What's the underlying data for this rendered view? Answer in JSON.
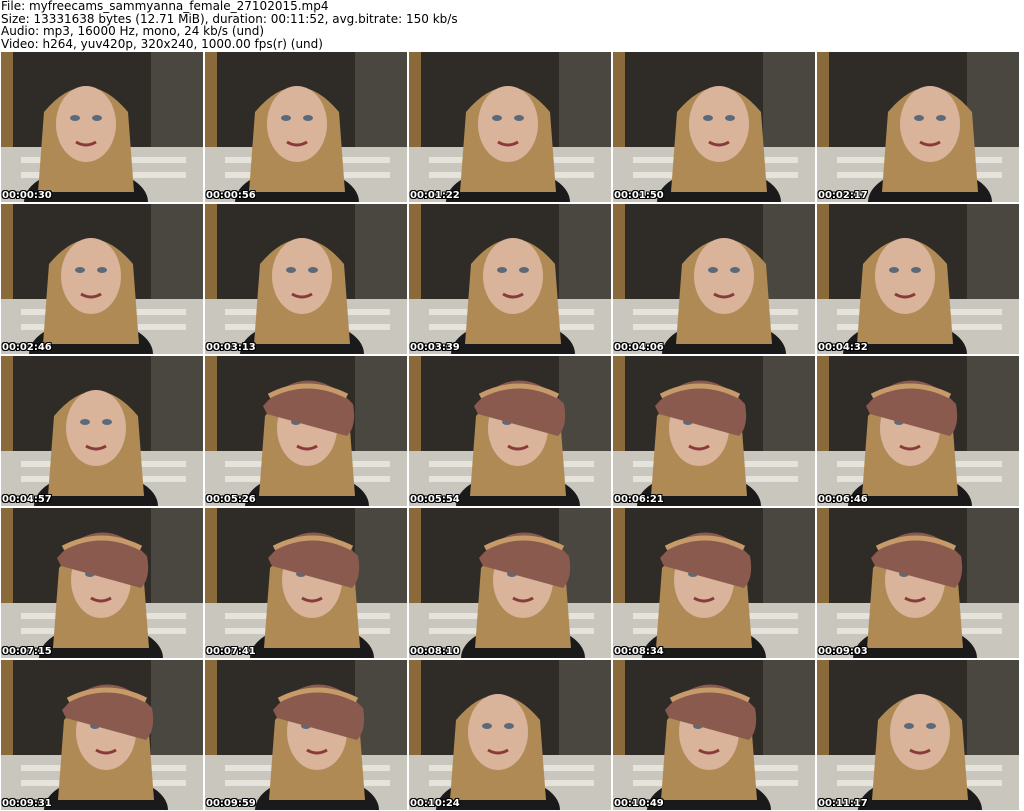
{
  "header": {
    "file_line": "File: myfreecams_sammyanna_female_27102015.mp4",
    "size_line": "Size: 13331638 bytes (12.71 MiB), duration: 00:11:52, avg.bitrate: 150 kb/s",
    "audio_line": "Audio: mp3, 16000 Hz, mono, 24 kb/s (und)",
    "video_line": "Video: h264, yuv420p, 320x240, 1000.00 fps(r) (und)"
  },
  "thumbnails": [
    {
      "timestamp": "00:00:30",
      "scarf": false
    },
    {
      "timestamp": "00:00:56",
      "scarf": false
    },
    {
      "timestamp": "00:01:22",
      "scarf": false
    },
    {
      "timestamp": "00:01:50",
      "scarf": false
    },
    {
      "timestamp": "00:02:17",
      "scarf": false
    },
    {
      "timestamp": "00:02:46",
      "scarf": false
    },
    {
      "timestamp": "00:03:13",
      "scarf": false
    },
    {
      "timestamp": "00:03:39",
      "scarf": false
    },
    {
      "timestamp": "00:04:06",
      "scarf": false
    },
    {
      "timestamp": "00:04:32",
      "scarf": false
    },
    {
      "timestamp": "00:04:57",
      "scarf": false
    },
    {
      "timestamp": "00:05:26",
      "scarf": true
    },
    {
      "timestamp": "00:05:54",
      "scarf": true
    },
    {
      "timestamp": "00:06:21",
      "scarf": true
    },
    {
      "timestamp": "00:06:46",
      "scarf": true
    },
    {
      "timestamp": "00:07:15",
      "scarf": true
    },
    {
      "timestamp": "00:07:41",
      "scarf": true
    },
    {
      "timestamp": "00:08:10",
      "scarf": true
    },
    {
      "timestamp": "00:08:34",
      "scarf": true
    },
    {
      "timestamp": "00:09:03",
      "scarf": true
    },
    {
      "timestamp": "00:09:31",
      "scarf": true
    },
    {
      "timestamp": "00:09:59",
      "scarf": true
    },
    {
      "timestamp": "00:10:24",
      "scarf": false
    },
    {
      "timestamp": "00:10:49",
      "scarf": true
    },
    {
      "timestamp": "00:11:17",
      "scarf": false
    }
  ],
  "colors": {
    "background": "#ffffff",
    "timestamp_text": "#ffffff",
    "timestamp_outline": "#000000",
    "room_dark": "#2f2c28",
    "wall": "#c9c6bd",
    "hair": "#b08a55",
    "skin": "#d9b39a",
    "scarf": "#8a5a4e",
    "shirt": "#1a1a1a"
  }
}
